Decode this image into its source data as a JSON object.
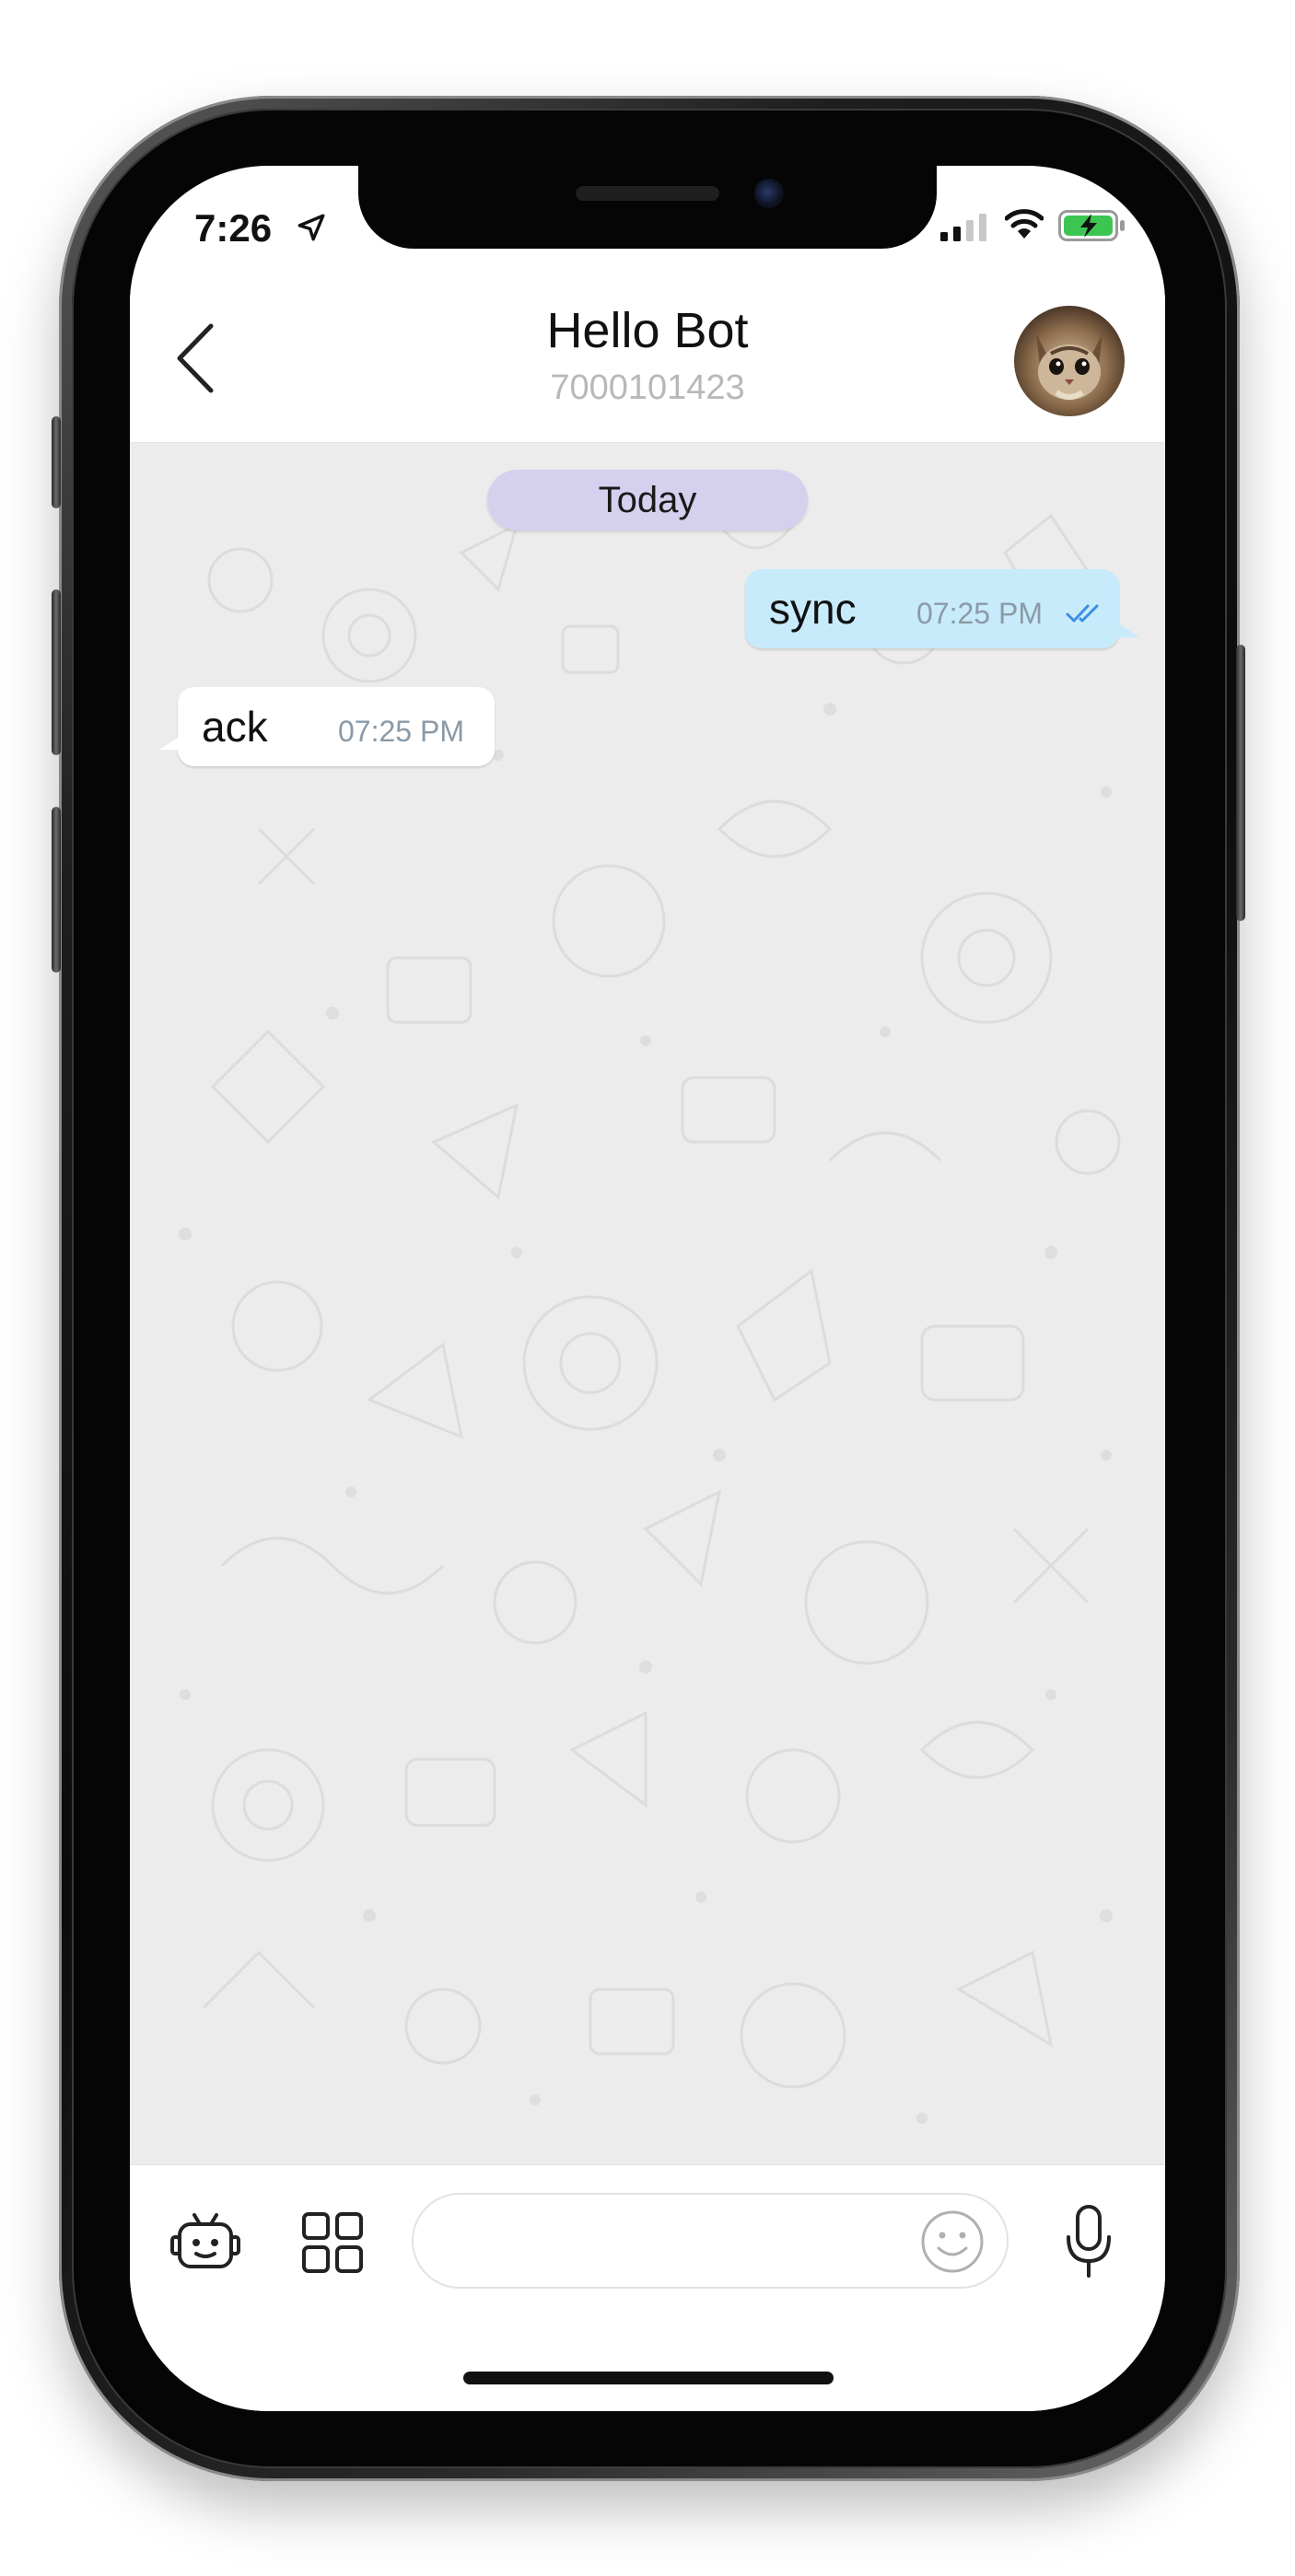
{
  "status_bar": {
    "time": "7:26",
    "icons": [
      "location-arrow-icon",
      "cellular-signal-icon",
      "wifi-icon",
      "battery-charging-icon"
    ]
  },
  "header": {
    "title": "Hello Bot",
    "subtitle": "7000101423",
    "back_icon": "chevron-left-icon",
    "avatar": "cat-avatar"
  },
  "chat": {
    "date_label": "Today",
    "messages": [
      {
        "direction": "outgoing",
        "text": "sync",
        "time": "07:25 PM",
        "status_icon": "double-check-icon"
      },
      {
        "direction": "incoming",
        "text": "ack",
        "time": "07:25 PM"
      }
    ]
  },
  "composer": {
    "input_value": "",
    "input_placeholder": "",
    "icons": [
      "bot-icon",
      "grid-icon",
      "emoji-icon",
      "microphone-icon"
    ]
  },
  "colors": {
    "outgoing_bubble": "#c8ebfb",
    "incoming_bubble": "#ffffff",
    "date_pill": "#d6d0ef",
    "tick_blue": "#3a8fe0",
    "chat_background": "#ececec"
  }
}
